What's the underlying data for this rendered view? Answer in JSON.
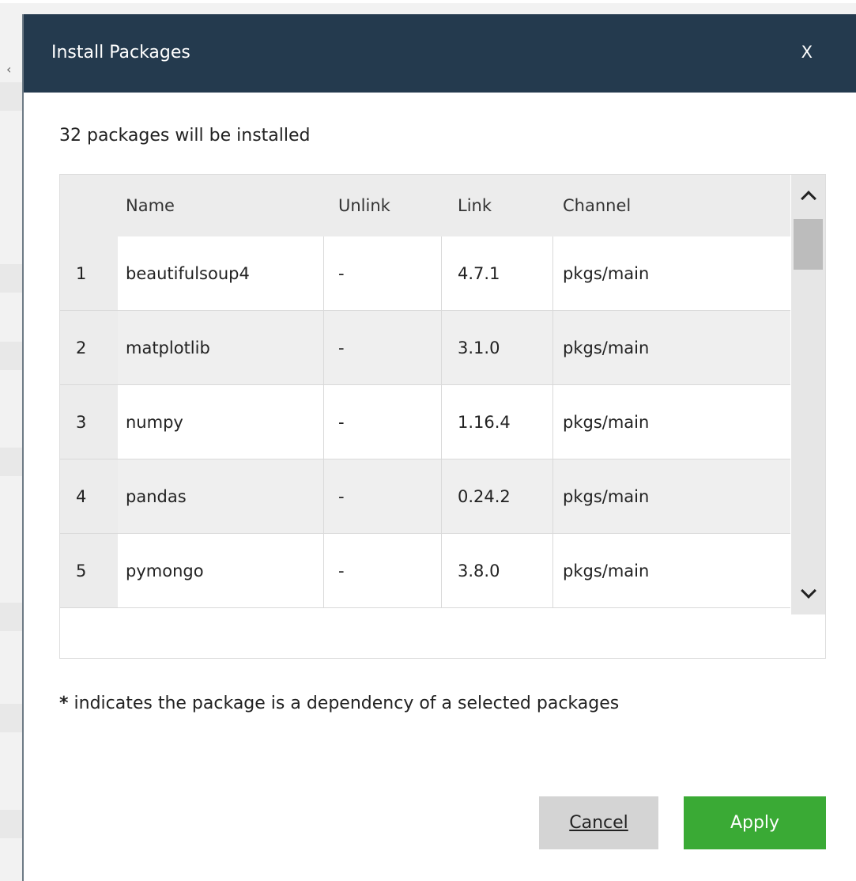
{
  "dialog": {
    "title": "Install Packages",
    "close_label": "X",
    "summary": "32 packages will be installed",
    "footnote_star": "*",
    "footnote_text": " indicates the package is a dependency of a selected packages"
  },
  "table": {
    "headers": {
      "name": "Name",
      "unlink": "Unlink",
      "link": "Link",
      "channel": "Channel"
    },
    "rows": [
      {
        "num": "1",
        "name": "beautifulsoup4",
        "unlink": "-",
        "link": "4.7.1",
        "channel": "pkgs/main"
      },
      {
        "num": "2",
        "name": "matplotlib",
        "unlink": "-",
        "link": "3.1.0",
        "channel": "pkgs/main"
      },
      {
        "num": "3",
        "name": "numpy",
        "unlink": "-",
        "link": "1.16.4",
        "channel": "pkgs/main"
      },
      {
        "num": "4",
        "name": "pandas",
        "unlink": "-",
        "link": "0.24.2",
        "channel": "pkgs/main"
      },
      {
        "num": "5",
        "name": "pymongo",
        "unlink": "-",
        "link": "3.8.0",
        "channel": "pkgs/main"
      }
    ]
  },
  "buttons": {
    "cancel": "Cancel",
    "apply": "Apply"
  },
  "colors": {
    "titlebar": "#243a4e",
    "apply": "#3aaa35",
    "cancel": "#d4d4d4"
  },
  "icons": {
    "scroll_up": "chevron-up-icon",
    "scroll_down": "chevron-down-icon"
  }
}
